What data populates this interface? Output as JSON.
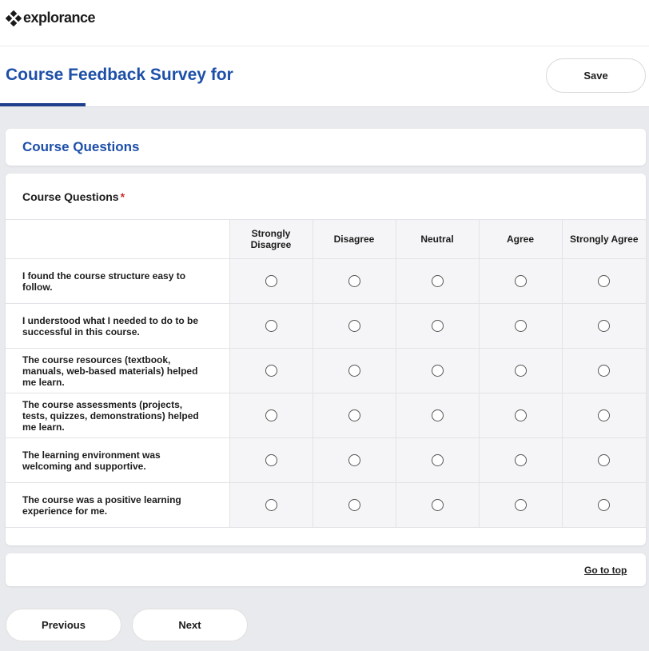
{
  "brand": {
    "logo_text": "explorance",
    "logo_icon": "diamond-cluster-icon"
  },
  "header": {
    "title": "Course Feedback Survey for",
    "save_label": "Save"
  },
  "section": {
    "title": "Course Questions"
  },
  "question": {
    "label": "Course Questions",
    "required_mark": "*",
    "columns": [
      "Strongly Disagree",
      "Disagree",
      "Neutral",
      "Agree",
      "Strongly Agree"
    ],
    "rows": [
      "I found the course structure easy to follow.",
      "I understood what I needed to do to be successful in this course.",
      "The course resources (textbook, manuals, web-based materials) helped me learn.",
      "The course assessments (projects, tests, quizzes, demonstrations) helped me learn.",
      "The learning environment was welcoming and supportive.",
      "The course was a positive learning experience for me."
    ]
  },
  "navigation": {
    "go_to_top": "Go to top",
    "previous": "Previous",
    "next": "Next"
  },
  "colors": {
    "accent": "#1d4fa8",
    "progress": "#1d3f8c",
    "required": "#d02a2a",
    "background": "#e9eaee"
  }
}
